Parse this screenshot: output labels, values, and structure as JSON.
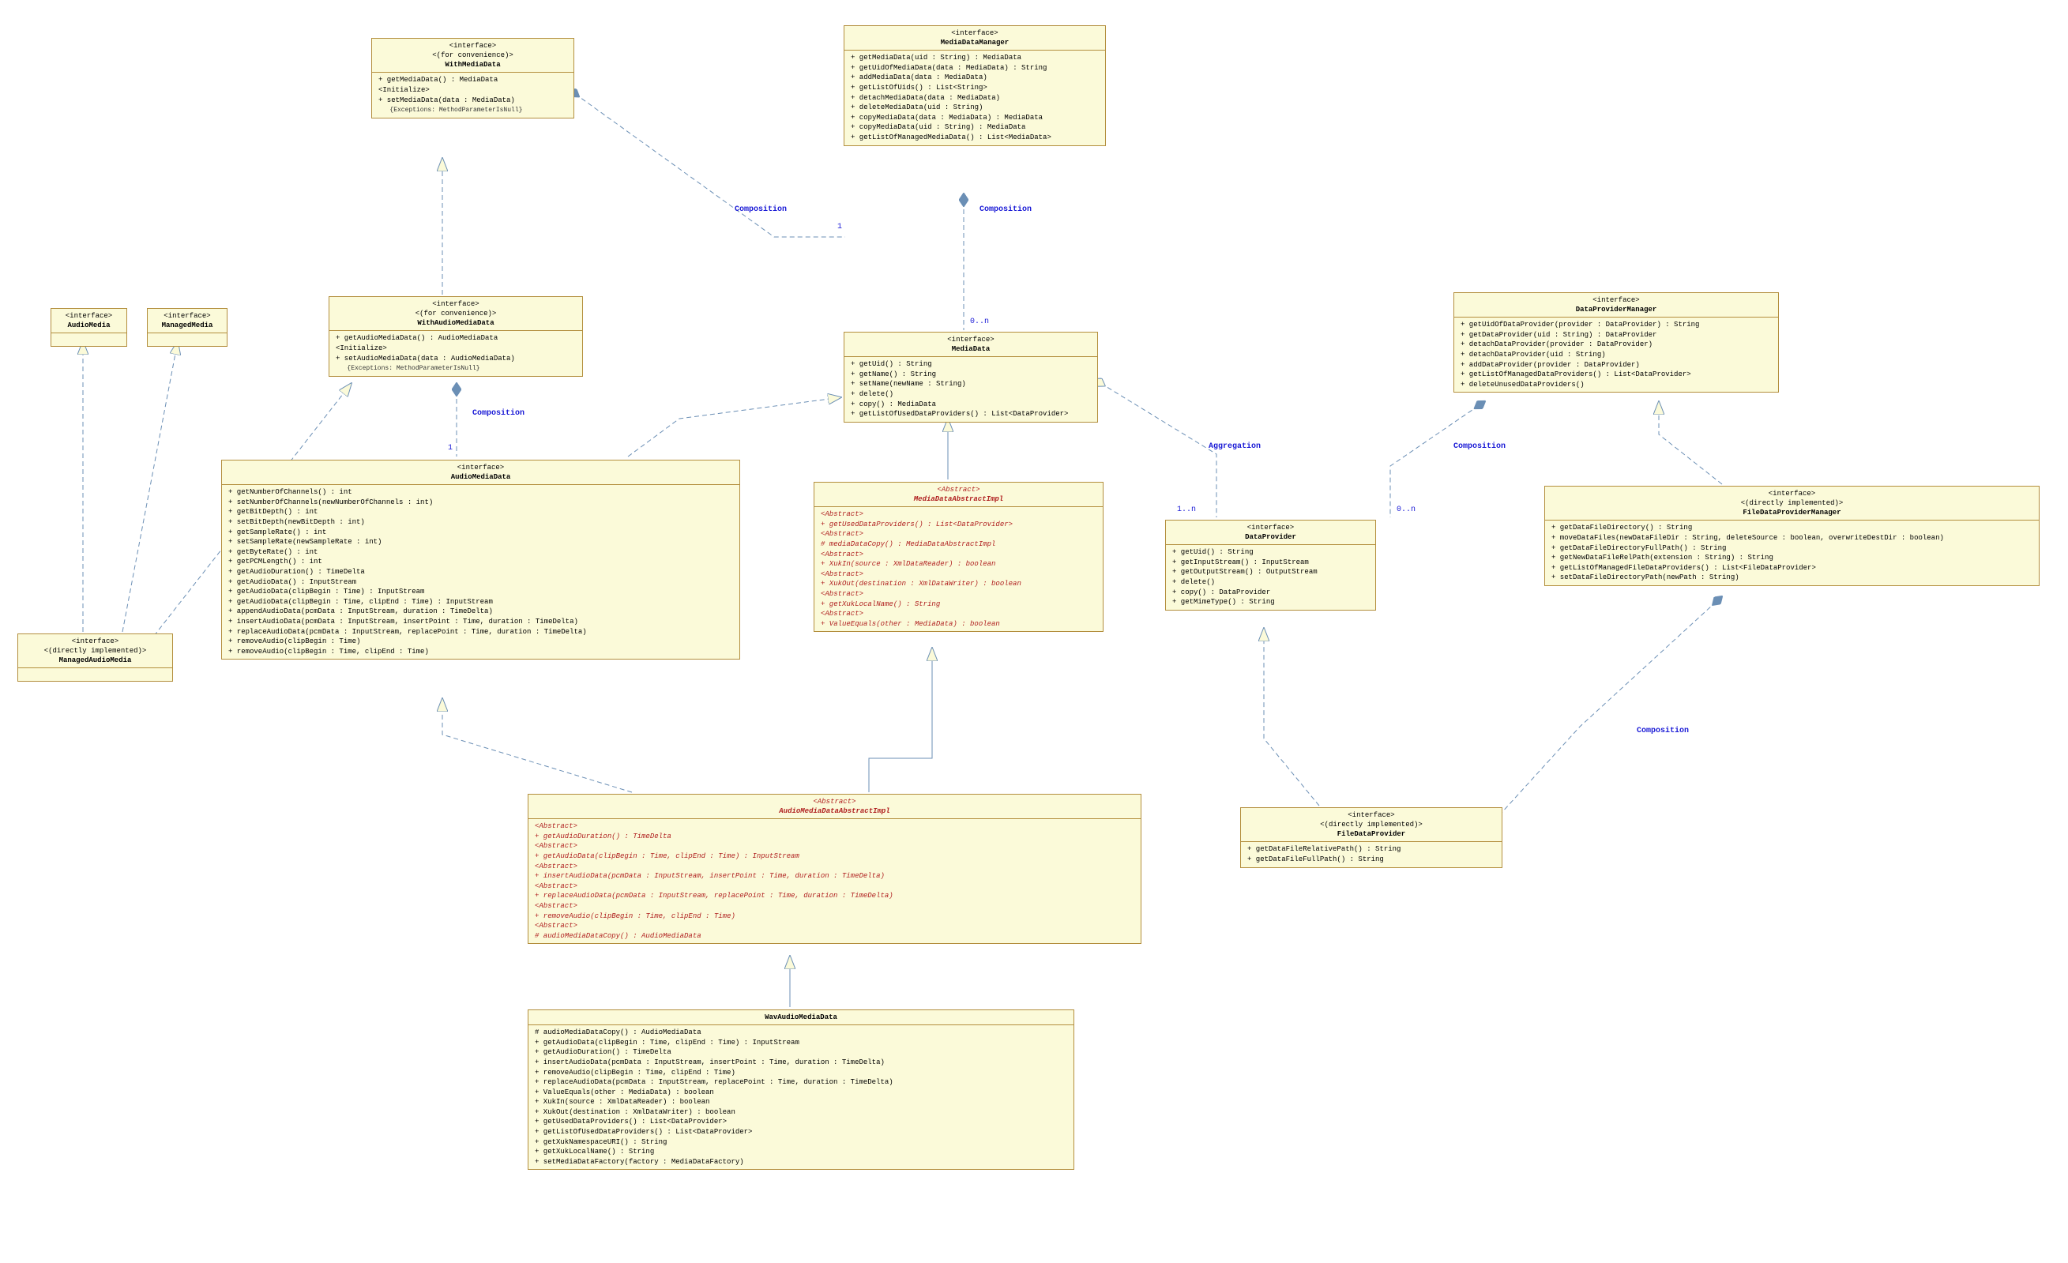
{
  "boxes": {
    "withMediaData": {
      "stereo": [
        "<interface>",
        "<(for convenience)>"
      ],
      "name": "WithMediaData",
      "ops": [
        "+ getMediaData() : MediaData",
        "<Initialize>",
        "+ setMediaData(data : MediaData)",
        "   {Exceptions: MethodParameterIsNull}"
      ]
    },
    "mediaDataManager": {
      "stereo": [
        "<interface>"
      ],
      "name": "MediaDataManager",
      "ops": [
        "+ getMediaData(uid : String) : MediaData",
        "+ getUidOfMediaData(data : MediaData) : String",
        "+ addMediaData(data : MediaData)",
        "+ getListOfUids() : List<String>",
        "+ detachMediaData(data : MediaData)",
        "+ deleteMediaData(uid : String)",
        "+ copyMediaData(data : MediaData) : MediaData",
        "+ copyMediaData(uid : String) : MediaData",
        "+ getListOfManagedMediaData() : List<MediaData>"
      ]
    },
    "audioMedia": {
      "stereo": [
        "<interface>"
      ],
      "name": "AudioMedia"
    },
    "managedMedia": {
      "stereo": [
        "<interface>"
      ],
      "name": "ManagedMedia"
    },
    "withAudioMediaData": {
      "stereo": [
        "<interface>",
        "<(for convenience)>"
      ],
      "name": "WithAudioMediaData",
      "ops": [
        "+ getAudioMediaData() : AudioMediaData",
        "<Initialize>",
        "+ setAudioMediaData(data : AudioMediaData)",
        "   {Exceptions: MethodParameterIsNull}"
      ]
    },
    "mediaData": {
      "stereo": [
        "<interface>"
      ],
      "name": "MediaData",
      "ops": [
        "+ getUid() : String",
        "+ getName() : String",
        "+ setName(newName : String)",
        "+ delete()",
        "+ copy() : MediaData",
        "+ getListOfUsedDataProviders() : List<DataProvider>"
      ]
    },
    "dataProviderManager": {
      "stereo": [
        "<interface>"
      ],
      "name": "DataProviderManager",
      "ops": [
        "+ getUidOfDataProvider(provider : DataProvider) : String",
        "+ getDataProvider(uid : String) : DataProvider",
        "+ detachDataProvider(provider : DataProvider)",
        "+ detachDataProvider(uid : String)",
        "+ addDataProvider(provider : DataProvider)",
        "+ getListOfManagedDataProviders() : List<DataProvider>",
        "+ deleteUnusedDataProviders()"
      ]
    },
    "audioMediaData": {
      "stereo": [
        "<interface>"
      ],
      "name": "AudioMediaData",
      "ops": [
        "+ getNumberOfChannels() : int",
        "+ setNumberOfChannels(newNumberOfChannels : int)",
        "+ getBitDepth() : int",
        "+ setBitDepth(newBitDepth : int)",
        "+ getSampleRate() : int",
        "+ setSampleRate(newSampleRate : int)",
        "+ getByteRate() : int",
        "+ getPCMLength() : int",
        "+ getAudioDuration() : TimeDelta",
        "+ getAudioData() : InputStream",
        "+ getAudioData(clipBegin : Time) : InputStream",
        "+ getAudioData(clipBegin : Time, clipEnd : Time) : InputStream",
        "+ appendAudioData(pcmData : InputStream, duration : TimeDelta)",
        "+ insertAudioData(pcmData : InputStream, insertPoint : Time, duration : TimeDelta)",
        "+ replaceAudioData(pcmData : InputStream, replacePoint : Time, duration : TimeDelta)",
        "+ removeAudio(clipBegin : Time)",
        "+ removeAudio(clipBegin : Time, clipEnd : Time)"
      ]
    },
    "mediaDataAbstractImpl": {
      "stereo": [
        "<Abstract>"
      ],
      "name": "MediaDataAbstractImpl",
      "ops": [
        "<Abstract>",
        "+ getUsedDataProviders() : List<DataProvider>",
        "<Abstract>",
        "# mediaDataCopy() : MediaDataAbstractImpl",
        "<Abstract>",
        "+ XukIn(source : XmlDataReader) : boolean",
        "<Abstract>",
        "+ XukOut(destination : XmlDataWriter) : boolean",
        "<Abstract>",
        "+ getXukLocalName() : String",
        "<Abstract>",
        "+ ValueEquals(other : MediaData) : boolean"
      ]
    },
    "dataProvider": {
      "stereo": [
        "<interface>"
      ],
      "name": "DataProvider",
      "ops": [
        "+ getUid() : String",
        "+ getInputStream() : InputStream",
        "+ getOutputStream() : OutputStream",
        "+ delete()",
        "+ copy() : DataProvider",
        "+ getMimeType() : String"
      ]
    },
    "fileDataProviderManager": {
      "stereo": [
        "<interface>",
        "<(directly implemented)>"
      ],
      "name": "FileDataProviderManager",
      "ops": [
        "+ getDataFileDirectory() : String",
        "+ moveDataFiles(newDataFileDir : String, deleteSource : boolean, overwriteDestDir : boolean)",
        "+ getDataFileDirectoryFullPath() : String",
        "+ getNewDataFileRelPath(extension : String) : String",
        "+ getListOfManagedFileDataProviders() : List<FileDataProvider>",
        "+ setDataFileDirectoryPath(newPath : String)"
      ]
    },
    "managedAudioMedia": {
      "stereo": [
        "<interface>",
        "<(directly implemented)>"
      ],
      "name": "ManagedAudioMedia"
    },
    "audioMediaDataAbstractImpl": {
      "stereo": [
        "<Abstract>"
      ],
      "name": "AudioMediaDataAbstractImpl",
      "ops": [
        "<Abstract>",
        "+ getAudioDuration() : TimeDelta",
        "<Abstract>",
        "+ getAudioData(clipBegin : Time, clipEnd : Time) : InputStream",
        "<Abstract>",
        "+ insertAudioData(pcmData : InputStream, insertPoint : Time, duration : TimeDelta)",
        "<Abstract>",
        "+ replaceAudioData(pcmData : InputStream, replacePoint : Time, duration : TimeDelta)",
        "<Abstract>",
        "+ removeAudio(clipBegin : Time, clipEnd : Time)",
        "<Abstract>",
        "# audioMediaDataCopy() : AudioMediaData"
      ]
    },
    "fileDataProvider": {
      "stereo": [
        "<interface>",
        "<(directly implemented)>"
      ],
      "name": "FileDataProvider",
      "ops": [
        "+ getDataFileRelativePath() : String",
        "+ getDataFileFullPath() : String"
      ]
    },
    "wavAudioMediaData": {
      "stereo": [],
      "name": "WavAudioMediaData",
      "ops": [
        "# audioMediaDataCopy() : AudioMediaData",
        "+ getAudioData(clipBegin : Time, clipEnd : Time) : InputStream",
        "+ getAudioDuration() : TimeDelta",
        "+ insertAudioData(pcmData : InputStream, insertPoint : Time, duration : TimeDelta)",
        "+ removeAudio(clipBegin : Time, clipEnd : Time)",
        "+ replaceAudioData(pcmData : InputStream, replacePoint : Time, duration : TimeDelta)",
        "+ ValueEquals(other : MediaData) : boolean",
        "+ XukIn(source : XmlDataReader) : boolean",
        "+ XukOut(destination : XmlDataWriter) : boolean",
        "+ getUsedDataProviders() : List<DataProvider>",
        "+ getListOfUsedDataProviders() : List<DataProvider>",
        "+ getXukNamespaceURI() : String",
        "+ getXukLocalName() : String",
        "+ setMediaDataFactory(factory : MediaDataFactory)"
      ]
    }
  },
  "labels": {
    "composition": "Composition",
    "aggregation": "Aggregation"
  },
  "mult": {
    "one": "1",
    "zeroN": "0..n",
    "oneN": "1..n"
  }
}
